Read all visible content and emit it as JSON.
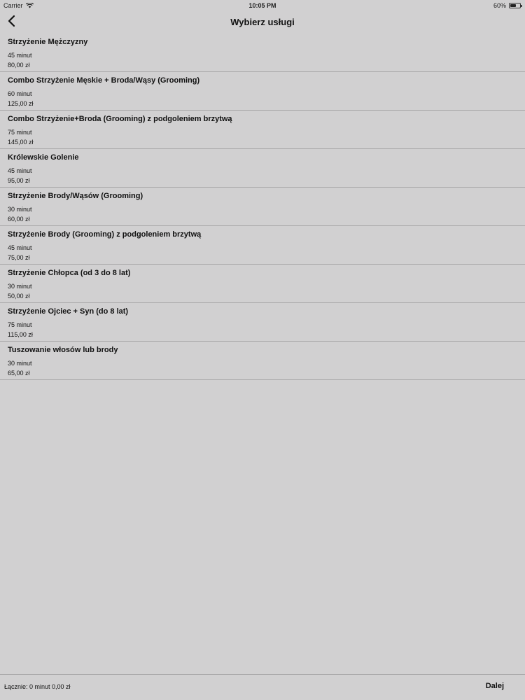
{
  "status_bar": {
    "carrier": "Carrier",
    "time": "10:05 PM",
    "battery_percent_label": "60%",
    "battery_level": 0.6,
    "wifi_icon": "wifi-icon",
    "battery_icon": "battery-icon"
  },
  "nav": {
    "title": "Wybierz usługi",
    "back_icon": "chevron-left-icon"
  },
  "services": [
    {
      "name": "Strzyżenie Mężczyzny",
      "duration": "45 minut",
      "price": "80,00 zł"
    },
    {
      "name": "Combo Strzyżenie Męskie + Broda/Wąsy (Grooming)",
      "duration": "60 minut",
      "price": "125,00 zł"
    },
    {
      "name": "Combo Strzyżenie+Broda (Grooming) z podgoleniem brzytwą",
      "duration": "75 minut",
      "price": "145,00 zł"
    },
    {
      "name": "Królewskie Golenie",
      "duration": "45 minut",
      "price": "95,00 zł"
    },
    {
      "name": "Strzyżenie Brody/Wąsów (Grooming)",
      "duration": "30 minut",
      "price": "60,00 zł"
    },
    {
      "name": "Strzyżenie Brody (Grooming) z podgoleniem brzytwą",
      "duration": "45 minut",
      "price": "75,00 zł"
    },
    {
      "name": "Strzyżenie Chłopca (od 3 do 8 lat)",
      "duration": "30 minut",
      "price": "50,00 zł"
    },
    {
      "name": "Strzyżenie Ojciec + Syn (do 8 lat)",
      "duration": "75 minut",
      "price": "115,00 zł"
    },
    {
      "name": "Tuszowanie włosów lub brody",
      "duration": "30 minut",
      "price": "65,00 zł"
    }
  ],
  "footer": {
    "total": "Łącznie: 0 minut 0,00 zł",
    "next_label": "Dalej"
  },
  "colors": {
    "background": "#d1d0d1",
    "separator": "#a9a8a9",
    "text": "#111111"
  }
}
